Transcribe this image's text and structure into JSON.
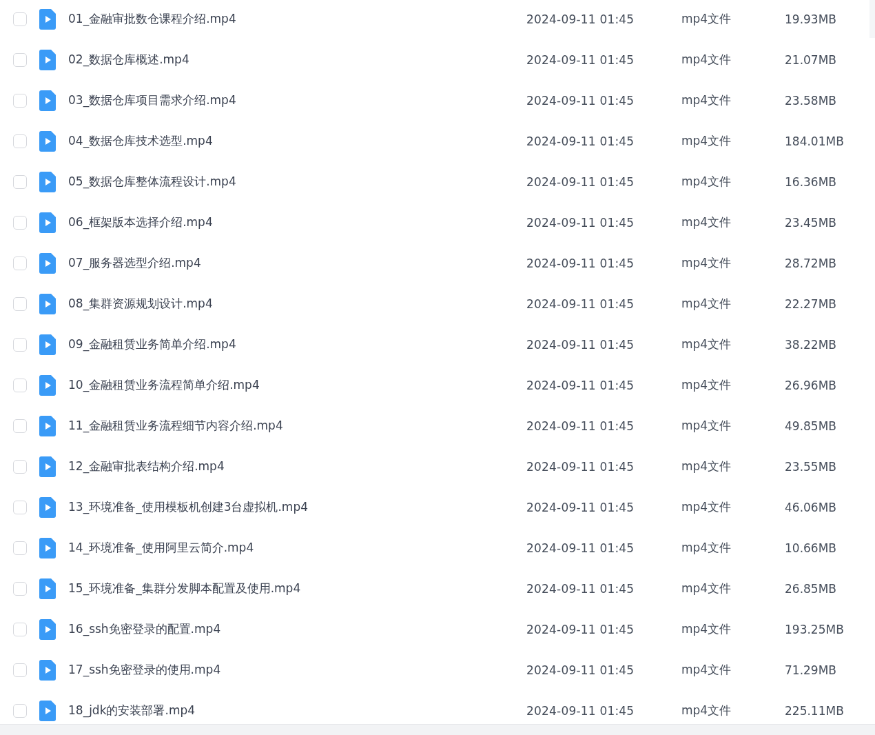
{
  "files": [
    {
      "name": "01_金融审批数仓课程介绍.mp4",
      "date": "2024-09-11 01:45",
      "type": "mp4文件",
      "size": "19.93MB",
      "checked": false
    },
    {
      "name": "02_数据仓库概述.mp4",
      "date": "2024-09-11 01:45",
      "type": "mp4文件",
      "size": "21.07MB",
      "checked": false
    },
    {
      "name": "03_数据仓库项目需求介绍.mp4",
      "date": "2024-09-11 01:45",
      "type": "mp4文件",
      "size": "23.58MB",
      "checked": false
    },
    {
      "name": "04_数据仓库技术选型.mp4",
      "date": "2024-09-11 01:45",
      "type": "mp4文件",
      "size": "184.01MB",
      "checked": false
    },
    {
      "name": "05_数据仓库整体流程设计.mp4",
      "date": "2024-09-11 01:45",
      "type": "mp4文件",
      "size": "16.36MB",
      "checked": false
    },
    {
      "name": "06_框架版本选择介绍.mp4",
      "date": "2024-09-11 01:45",
      "type": "mp4文件",
      "size": "23.45MB",
      "checked": false
    },
    {
      "name": "07_服务器选型介绍.mp4",
      "date": "2024-09-11 01:45",
      "type": "mp4文件",
      "size": "28.72MB",
      "checked": false
    },
    {
      "name": "08_集群资源规划设计.mp4",
      "date": "2024-09-11 01:45",
      "type": "mp4文件",
      "size": "22.27MB",
      "checked": false
    },
    {
      "name": "09_金融租赁业务简单介绍.mp4",
      "date": "2024-09-11 01:45",
      "type": "mp4文件",
      "size": "38.22MB",
      "checked": false
    },
    {
      "name": "10_金融租赁业务流程简单介绍.mp4",
      "date": "2024-09-11 01:45",
      "type": "mp4文件",
      "size": "26.96MB",
      "checked": false
    },
    {
      "name": "11_金融租赁业务流程细节内容介绍.mp4",
      "date": "2024-09-11 01:45",
      "type": "mp4文件",
      "size": "49.85MB",
      "checked": false
    },
    {
      "name": "12_金融审批表结构介绍.mp4",
      "date": "2024-09-11 01:45",
      "type": "mp4文件",
      "size": "23.55MB",
      "checked": false
    },
    {
      "name": "13_环境准备_使用模板机创建3台虚拟机.mp4",
      "date": "2024-09-11 01:45",
      "type": "mp4文件",
      "size": "46.06MB",
      "checked": false
    },
    {
      "name": "14_环境准备_使用阿里云简介.mp4",
      "date": "2024-09-11 01:45",
      "type": "mp4文件",
      "size": "10.66MB",
      "checked": false
    },
    {
      "name": "15_环境准备_集群分发脚本配置及使用.mp4",
      "date": "2024-09-11 01:45",
      "type": "mp4文件",
      "size": "26.85MB",
      "checked": false
    },
    {
      "name": "16_ssh免密登录的配置.mp4",
      "date": "2024-09-11 01:45",
      "type": "mp4文件",
      "size": "193.25MB",
      "checked": false
    },
    {
      "name": "17_ssh免密登录的使用.mp4",
      "date": "2024-09-11 01:45",
      "type": "mp4文件",
      "size": "71.29MB",
      "checked": false
    },
    {
      "name": "18_jdk的安装部署.mp4",
      "date": "2024-09-11 01:45",
      "type": "mp4文件",
      "size": "225.11MB",
      "checked": false
    }
  ]
}
